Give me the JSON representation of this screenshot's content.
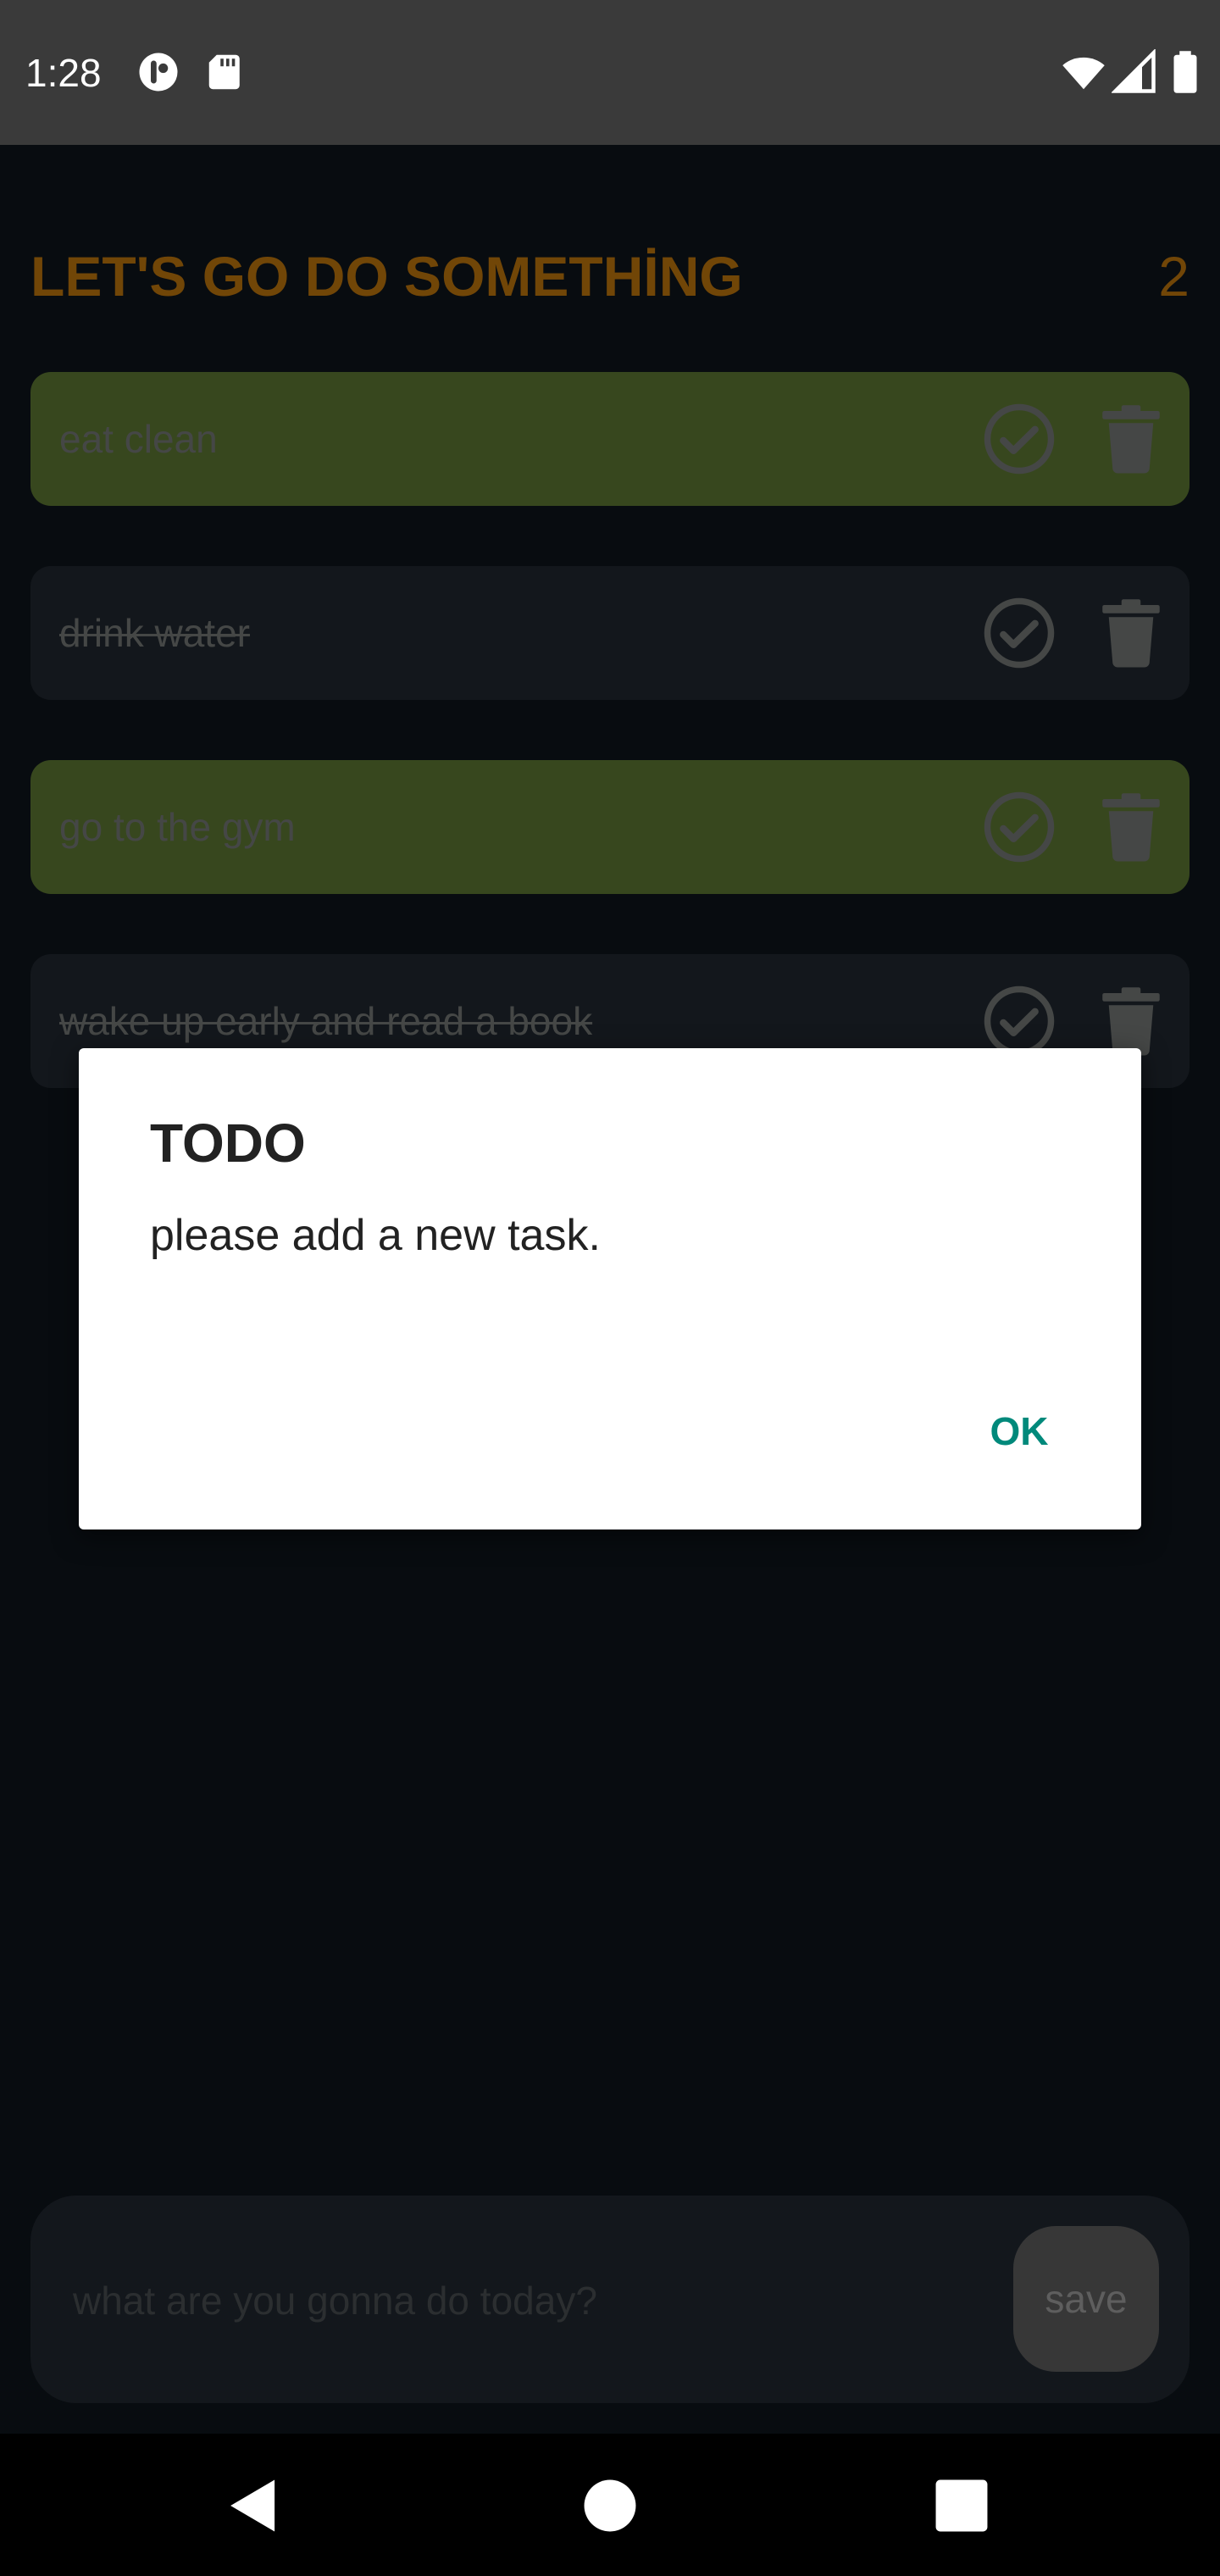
{
  "status_bar": {
    "time": "1:28",
    "icons": [
      "data-saver-icon",
      "sd-card-icon",
      "wifi-icon",
      "cell-signal-icon",
      "battery-icon"
    ]
  },
  "header": {
    "title": "LET'S GO DO SOMETHİNG",
    "count": "2",
    "accent_color": "#E38C0E"
  },
  "tasks": [
    {
      "label": "eat clean",
      "state": "active"
    },
    {
      "label": "drink water ",
      "state": "done"
    },
    {
      "label": "go to the gym",
      "state": "active"
    },
    {
      "label": "wake up early and read a book",
      "state": "done"
    }
  ],
  "task_colors": {
    "active": "#6E8F3C",
    "done": "#262E38"
  },
  "input": {
    "placeholder": "what are you gonna do today?",
    "value": "",
    "save_label": "save"
  },
  "dialog": {
    "title": "TODO",
    "message": "please add a new task.",
    "ok_label": "OK",
    "ok_color": "#00897B"
  },
  "nav_bar": {
    "icons": [
      "back-icon",
      "home-icon",
      "recents-icon"
    ]
  }
}
